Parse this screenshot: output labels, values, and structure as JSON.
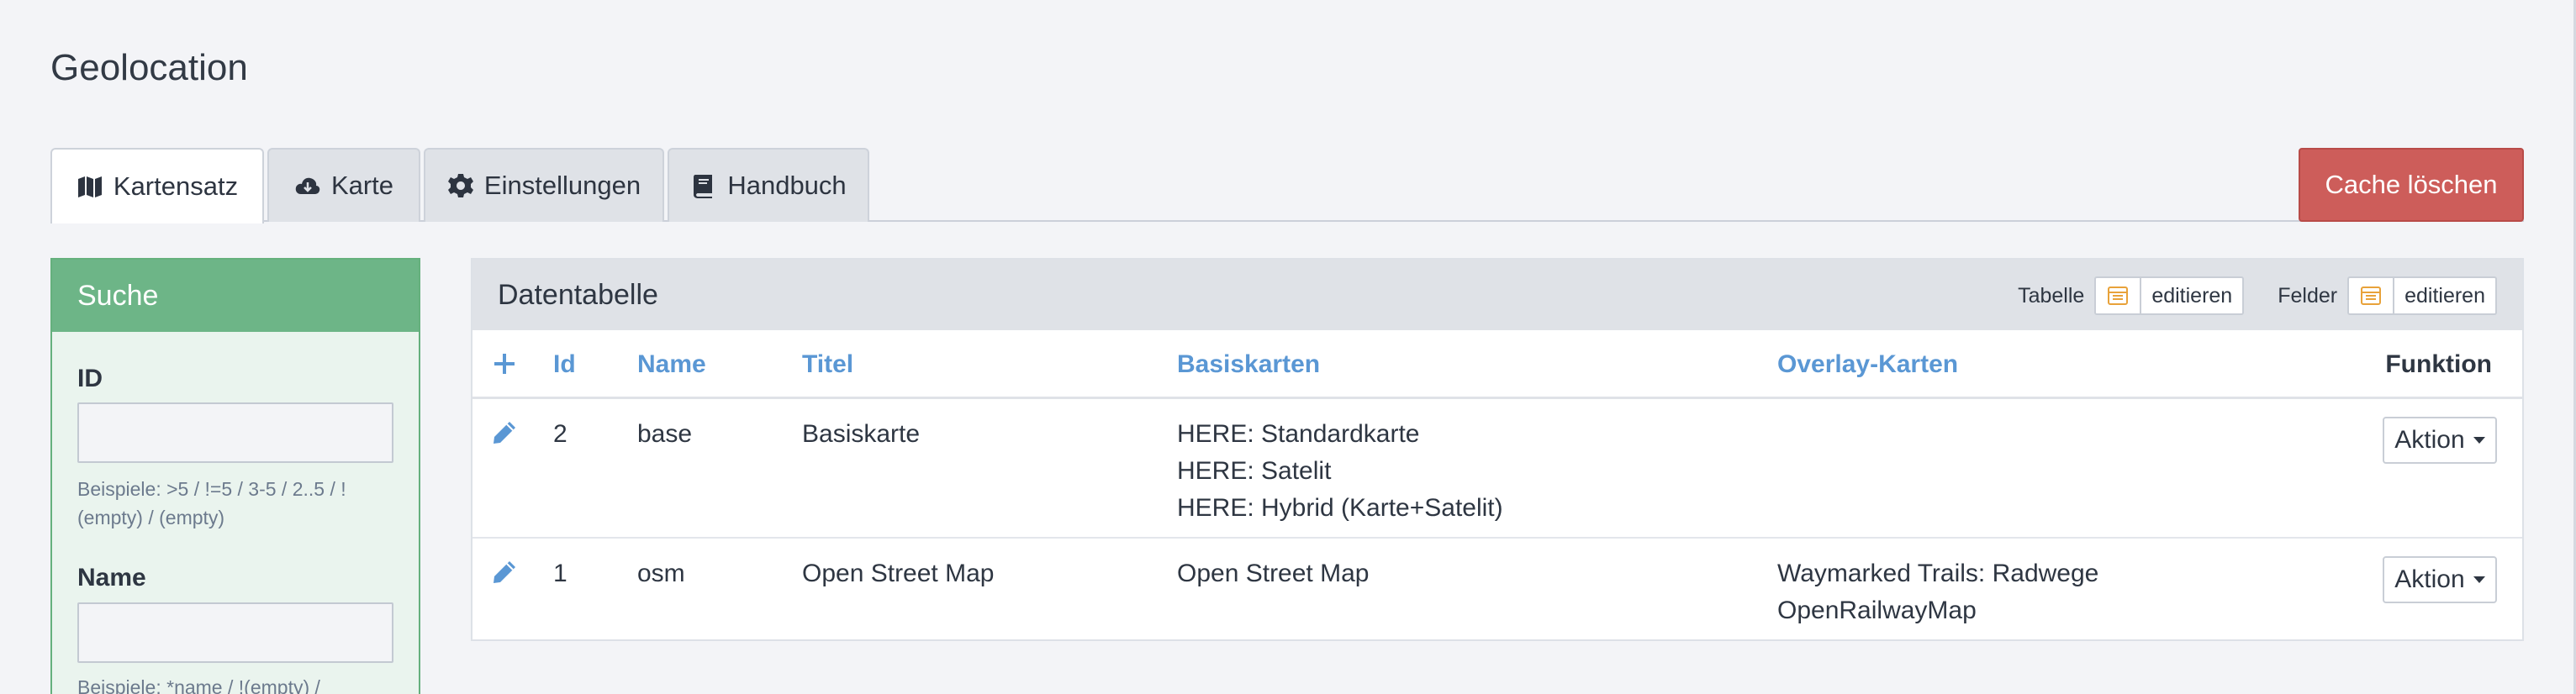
{
  "page": {
    "title": "Geolocation"
  },
  "tabs": [
    {
      "label": "Kartensatz",
      "icon": "map-icon",
      "active": true
    },
    {
      "label": "Karte",
      "icon": "cloud-download-icon",
      "active": false
    },
    {
      "label": "Einstellungen",
      "icon": "gear-icon",
      "active": false
    },
    {
      "label": "Handbuch",
      "icon": "book-icon",
      "active": false
    }
  ],
  "cache_button": {
    "label": "Cache löschen",
    "color": "#cd5d5a"
  },
  "search": {
    "title": "Suche",
    "fields": [
      {
        "label": "ID",
        "value": "",
        "hint": "Beispiele: >5 / !=5 / 3-5 / 2..5 / ! (empty) / (empty)"
      },
      {
        "label": "Name",
        "value": "",
        "hint": "Beispiele: *name / !(empty) /"
      }
    ]
  },
  "table": {
    "title": "Datentabelle",
    "tools": [
      {
        "label": "Tabelle",
        "button": "editieren",
        "icon": "table-icon"
      },
      {
        "label": "Felder",
        "button": "editieren",
        "icon": "table-icon"
      }
    ],
    "columns": {
      "add": "+",
      "id": "Id",
      "name": "Name",
      "titel": "Titel",
      "basiskarten": "Basiskarten",
      "overlay": "Overlay-Karten",
      "funktion": "Funktion"
    },
    "rows": [
      {
        "id": "2",
        "name": "base",
        "titel": "Basiskarte",
        "basiskarten": [
          "HERE: Standardkarte",
          "HERE: Satelit",
          "HERE: Hybrid (Karte+Satelit)"
        ],
        "overlay": [],
        "action": "Aktion"
      },
      {
        "id": "1",
        "name": "osm",
        "titel": "Open Street Map",
        "basiskarten": [
          "Open Street Map"
        ],
        "overlay": [
          "Waymarked Trails: Radwege",
          "OpenRailwayMap"
        ],
        "action": "Aktion"
      }
    ]
  },
  "colors": {
    "accent": "#5a97d4",
    "search_green": "#6db587",
    "danger": "#cd5d5a"
  }
}
